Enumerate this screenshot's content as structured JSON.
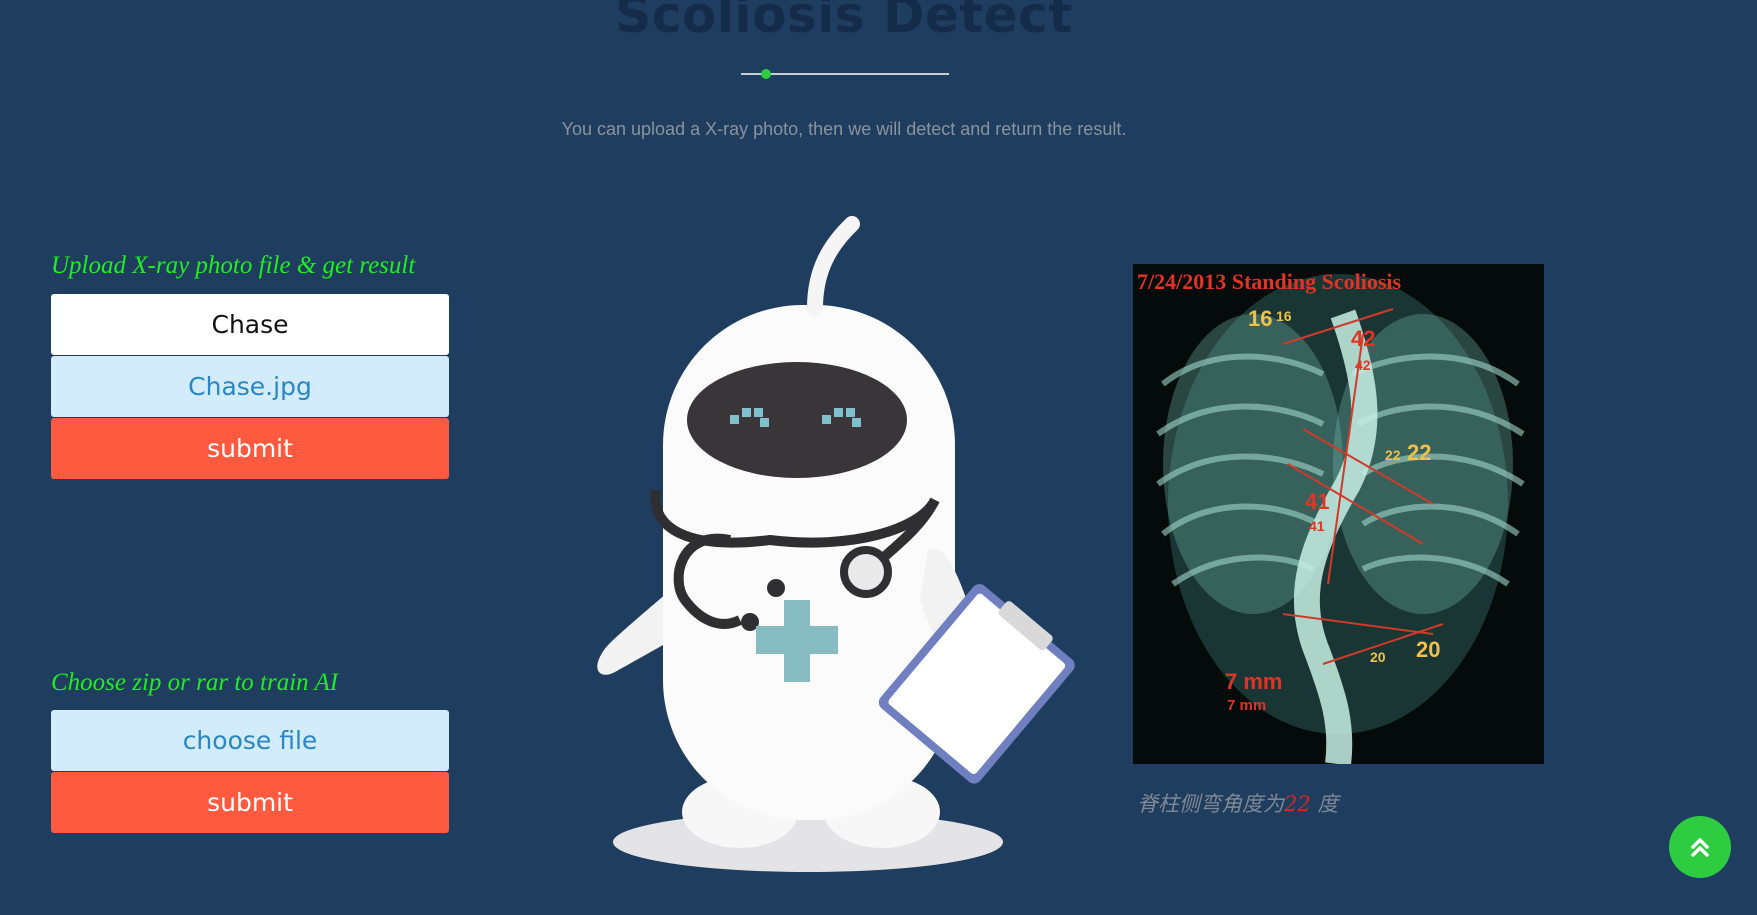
{
  "header": {
    "title": "Scoliosis Detect",
    "subtitle": "You can upload a X-ray photo, then we will detect and return the result."
  },
  "upload_section": {
    "label": "Upload X-ray photo file & get result",
    "name_button": "Chase",
    "file_button": "Chase.jpg",
    "submit_button": "submit"
  },
  "train_section": {
    "label": "Choose zip or rar to train AI",
    "choose_button": "choose file",
    "submit_button": "submit"
  },
  "result": {
    "xray_banner": "7/24/2013 Standing Scoliosis",
    "xray_labels": [
      "16",
      "16",
      "42",
      "42",
      "22",
      "22",
      "41",
      "41",
      "20",
      "20",
      "7 mm",
      "7 mm"
    ],
    "caption_prefix": "脊柱侧弯角度为",
    "caption_value": "22",
    "caption_suffix": " 度"
  },
  "icons": {
    "scroll_top": "double-chevron-up-icon",
    "robot": "doctor-robot-illustration"
  },
  "colors": {
    "background": "#1f3d5e",
    "label_green": "#1eef1e",
    "submit_red": "#fd5a3f",
    "file_blue_bg": "#d2ecfb",
    "scroll_green": "#2ecc40",
    "angle_red": "#e0241d"
  }
}
